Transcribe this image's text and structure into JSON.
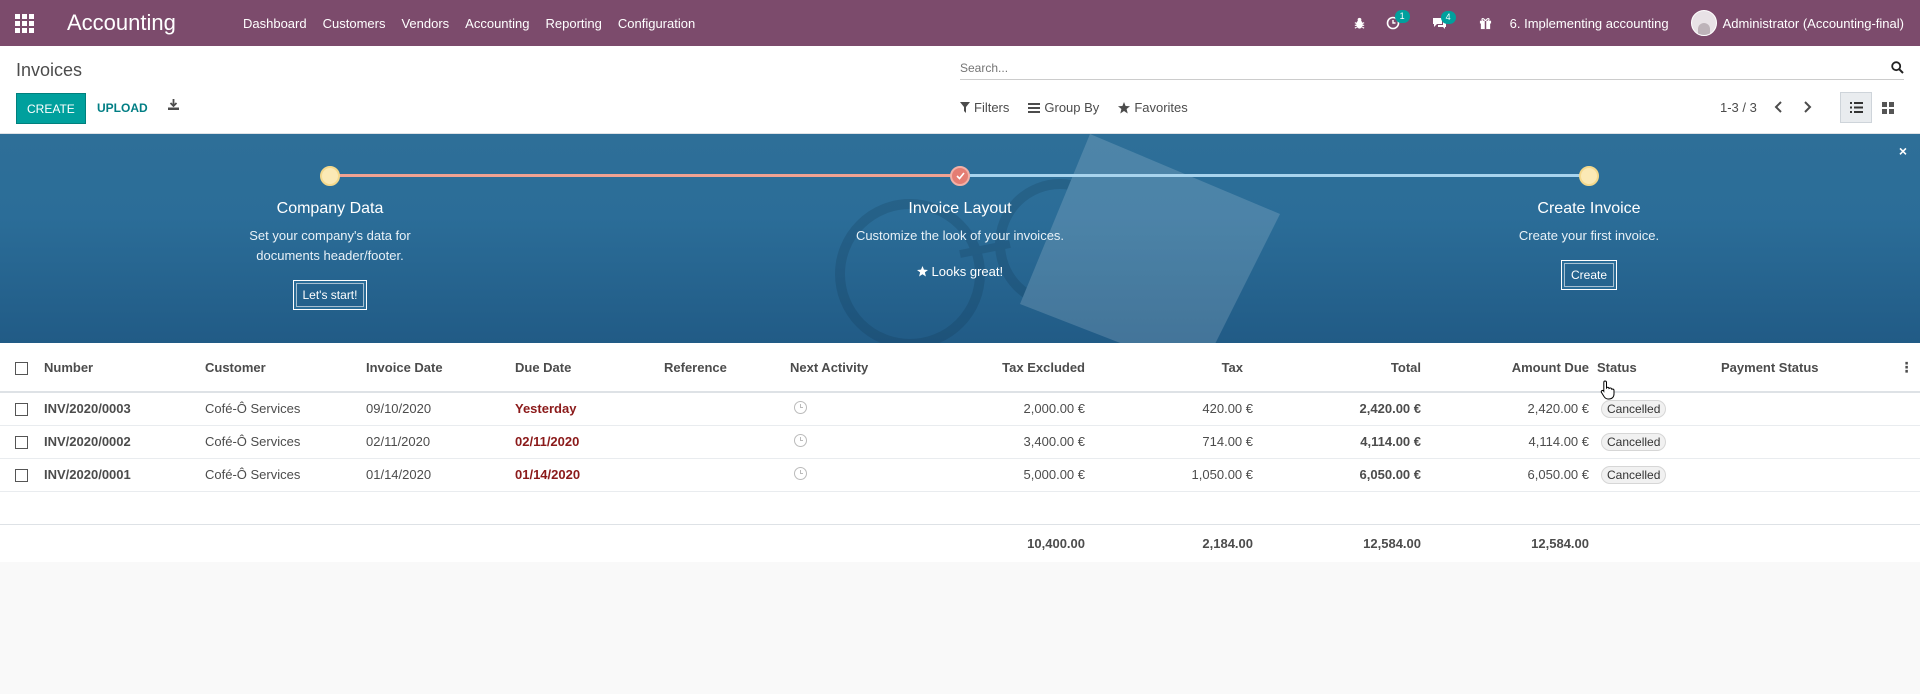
{
  "navbar": {
    "app_title": "Accounting",
    "menu": [
      "Dashboard",
      "Customers",
      "Vendors",
      "Accounting",
      "Reporting",
      "Configuration"
    ],
    "activity_count": "1",
    "messages_count": "4",
    "company": "6. Implementing accounting",
    "user": "Administrator (Accounting-final)"
  },
  "control": {
    "title": "Invoices",
    "create_label": "CREATE",
    "upload_label": "UPLOAD",
    "search_placeholder": "Search...",
    "filters_label": "Filters",
    "groupby_label": "Group By",
    "favorites_label": "Favorites",
    "pager": "1-3 / 3"
  },
  "banner": {
    "steps": [
      {
        "title": "Company Data",
        "desc_line1": "Set your company's data for",
        "desc_line2": "documents header/footer.",
        "button": "Let's start!"
      },
      {
        "title": "Invoice Layout",
        "desc_line1": "Customize the look of your invoices.",
        "note": "Looks great!"
      },
      {
        "title": "Create Invoice",
        "desc_line1": "Create your first invoice.",
        "button": "Create"
      }
    ],
    "close": "×"
  },
  "table": {
    "headers": [
      "Number",
      "Customer",
      "Invoice Date",
      "Due Date",
      "Reference",
      "Next Activity",
      "Tax Excluded",
      "Tax",
      "Total",
      "Amount Due",
      "Status",
      "Payment Status"
    ],
    "rows": [
      {
        "number": "INV/2020/0003",
        "customer": "Cofé-Ô Services",
        "invoice_date": "09/10/2020",
        "due_date": "Yesterday",
        "reference": "",
        "tax_excluded": "2,000.00 €",
        "tax": "420.00 €",
        "total": "2,420.00 €",
        "amount_due": "2,420.00 €",
        "status": "Cancelled",
        "payment_status": ""
      },
      {
        "number": "INV/2020/0002",
        "customer": "Cofé-Ô Services",
        "invoice_date": "02/11/2020",
        "due_date": "02/11/2020",
        "reference": "",
        "tax_excluded": "3,400.00 €",
        "tax": "714.00 €",
        "total": "4,114.00 €",
        "amount_due": "4,114.00 €",
        "status": "Cancelled",
        "payment_status": ""
      },
      {
        "number": "INV/2020/0001",
        "customer": "Cofé-Ô Services",
        "invoice_date": "01/14/2020",
        "due_date": "01/14/2020",
        "reference": "",
        "tax_excluded": "5,000.00 €",
        "tax": "1,050.00 €",
        "total": "6,050.00 €",
        "amount_due": "6,050.00 €",
        "status": "Cancelled",
        "payment_status": ""
      }
    ],
    "totals": {
      "tax_excluded": "10,400.00",
      "tax": "2,184.00",
      "total": "12,584.00",
      "amount_due": "12,584.00"
    }
  },
  "colors": {
    "navbar": "#7c4b6c",
    "primary": "#00a09d",
    "overdue": "#8b1a1a",
    "banner": "#2b6d98"
  },
  "icons": [
    "apps-grid-icon",
    "bug-icon",
    "clock-icon",
    "chat-icon",
    "gift-icon",
    "search-icon",
    "download-icon",
    "filter-icon",
    "list-view-icon",
    "kanban-view-icon",
    "check-icon",
    "star-icon",
    "close-icon"
  ]
}
